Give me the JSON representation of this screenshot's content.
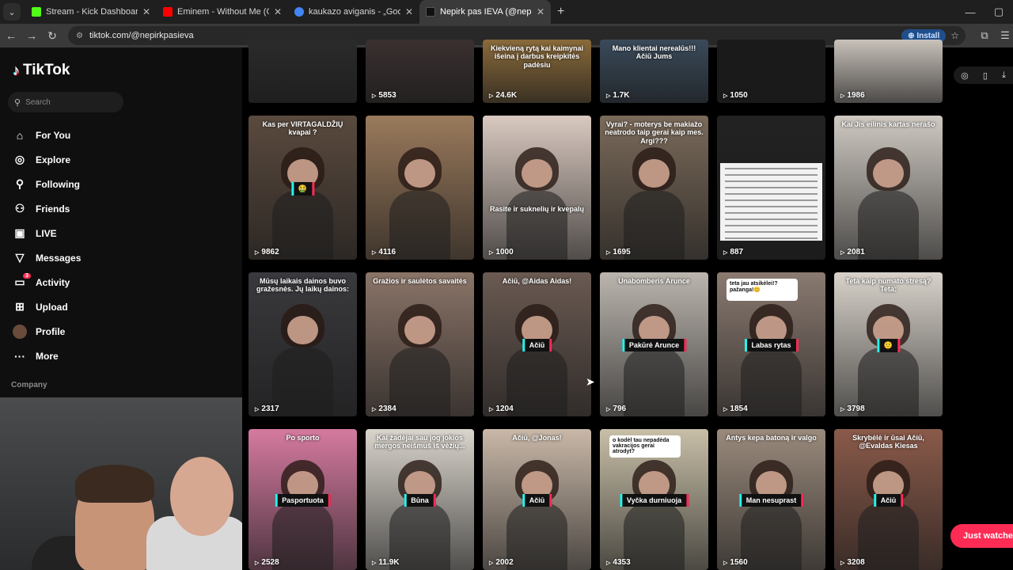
{
  "browser": {
    "tabs": [
      {
        "title": "Stream - Kick Dashboard",
        "favicon_color": "#53fc18",
        "active": false
      },
      {
        "title": "Eminem - Without Me (Official",
        "favicon_color": "#ff0000",
        "active": false
      },
      {
        "title": "kaukazo aviganis - „Google“ pa",
        "favicon_color": "#4285f4",
        "active": false
      },
      {
        "title": "Nepirk pas IEVA (@nepirkpasie",
        "favicon_color": "#111111",
        "active": true
      }
    ],
    "new_tab": "+",
    "url": "tiktok.com/@nepirkpasieva",
    "install_label": "Install"
  },
  "sidebar": {
    "logo": "TikTok",
    "search_placeholder": "Search",
    "items": [
      {
        "label": "For You",
        "icon": "home-icon",
        "glyph": "⌂"
      },
      {
        "label": "Explore",
        "icon": "compass-icon",
        "glyph": "◎"
      },
      {
        "label": "Following",
        "icon": "following-icon",
        "glyph": "⚲"
      },
      {
        "label": "Friends",
        "icon": "friends-icon",
        "glyph": "⚇"
      },
      {
        "label": "LIVE",
        "icon": "live-icon",
        "glyph": "▣"
      },
      {
        "label": "Messages",
        "icon": "messages-icon",
        "glyph": "▽"
      },
      {
        "label": "Activity",
        "icon": "activity-icon",
        "glyph": "▭",
        "badge": "3"
      },
      {
        "label": "Upload",
        "icon": "upload-icon",
        "glyph": "⊞"
      },
      {
        "label": "Profile",
        "icon": "avatar-icon",
        "glyph": ""
      },
      {
        "label": "More",
        "icon": "more-icon",
        "glyph": "···"
      }
    ],
    "company": "Company"
  },
  "videos": [
    {
      "views": "",
      "caption": "",
      "bg": "#2b2b2b"
    },
    {
      "views": "5853",
      "caption": "",
      "bg": "#3a3030"
    },
    {
      "views": "24.6K",
      "caption": "Kiekvieną rytą kai kaimynai išeina į darbus kreipkitės padėsiu",
      "bg": "#8a6a3a"
    },
    {
      "views": "1.7K",
      "caption": "Mano klientai nerealūs!!! Ačiū Jums",
      "bg": "#3a4a5a"
    },
    {
      "views": "1050",
      "caption": "",
      "bg": "#1a1a1a"
    },
    {
      "views": "1986",
      "caption": "",
      "bg": "#c9c2bb"
    },
    {
      "views": "9862",
      "caption": "Kas per VIRTAGALDŽIŲ kvapai ?",
      "tag": "🤮",
      "bg": "#5a4a3e"
    },
    {
      "views": "4116",
      "caption": "",
      "bg": "#9a7a5c"
    },
    {
      "views": "1000",
      "caption": "",
      "mid": "Rasite ir suknelių ir kvepalų",
      "bg": "#d9c9c0"
    },
    {
      "views": "1695",
      "caption": "Vyrai? - moterys be makiažo neatrodo taip gerai kaip mes. Argi???",
      "bg": "#7a6a5a"
    },
    {
      "views": "887",
      "caption": "",
      "doc": true,
      "bg": "#222"
    },
    {
      "views": "2081",
      "caption": "Kai Jis eilinis kartas nerašo",
      "bg": "#cfc9c2"
    },
    {
      "views": "2317",
      "caption": "Mūsų laikais dainos buvo gražesnės. Jų laikų dainos:",
      "bg": "#3a3a3e"
    },
    {
      "views": "2384",
      "caption": "Gražios ir saulėtos savaitės",
      "bg": "#8a7468"
    },
    {
      "views": "1204",
      "caption": "Ačiū, @Aidas Aidas!",
      "tag": "Ačiū",
      "bg": "#6a5a52"
    },
    {
      "views": "796",
      "caption": "Unabomberis Arunce",
      "tag": "Pakūrė Arunce",
      "bg": "#bbb5ae"
    },
    {
      "views": "1854",
      "caption": "",
      "comment": "teta jau atsikėlei!? pažanga!😊",
      "tag": "Labas rytas",
      "bg": "#8a7a70"
    },
    {
      "views": "3798",
      "caption": "Teta kaip numato stresą? Teta:",
      "tag": "🙂",
      "bg": "#d8d2ca"
    },
    {
      "views": "2528",
      "caption": "Po sporto",
      "tag": "Pasportuota",
      "bg": "#d57aa0"
    },
    {
      "views": "11.9K",
      "caption": "Kai žadėjai sau jog jokios mergos neišmuš iš vėžių...",
      "tag": "Būna",
      "bg": "#d9d4cc"
    },
    {
      "views": "2002",
      "caption": "Ačiū, @Jonas!",
      "tag": "Ačiū",
      "bg": "#c9b8a8"
    },
    {
      "views": "4353",
      "caption": "",
      "comment": "o kodėl tau nepadėda vakracijos gerai atrodyt?",
      "tag": "Vyčka durniuoja",
      "bg": "#c8bfa8"
    },
    {
      "views": "1560",
      "caption": "Antys kepa batoną ir valgo",
      "tag": "Man nesuprast",
      "bg": "#9a8a7c"
    },
    {
      "views": "3208",
      "caption": "Skrybėlė ir ūsai Ačiū, @Evaldas Kiesas",
      "tag": "Ačiū",
      "bg": "#8a5a4a"
    }
  ],
  "just_watched": "Just watched",
  "colors": {
    "accent": "#fe2c55",
    "cyan": "#25f4ee"
  }
}
